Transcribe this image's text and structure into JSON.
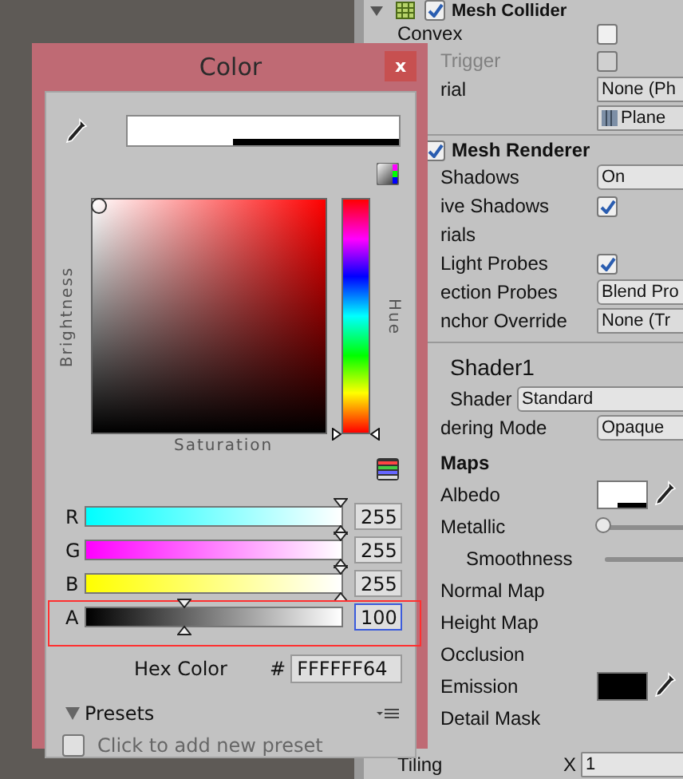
{
  "dialog": {
    "title": "Color",
    "close_label": "x",
    "brightness_label": "Brightness",
    "hue_label": "Hue",
    "saturation_label": "Saturation",
    "hue_slider": {
      "level": 0
    },
    "channels": [
      {
        "kind": "r",
        "label": "R",
        "level": 1,
        "value": "255",
        "focused": false,
        "highlighted": false
      },
      {
        "kind": "g",
        "label": "G",
        "level": 1,
        "value": "255",
        "focused": false,
        "highlighted": false
      },
      {
        "kind": "b",
        "label": "B",
        "level": 1,
        "value": "255",
        "focused": false,
        "highlighted": false
      },
      {
        "kind": "a",
        "label": "A",
        "level": 0.39,
        "value": "100",
        "focused": true,
        "highlighted": true
      }
    ],
    "hex": {
      "label": "Hex Color",
      "prefix": "#",
      "value": "FFFFFF64"
    },
    "presets": {
      "title": "Presets",
      "expanded": true,
      "hint": "Click to add new preset"
    }
  },
  "inspector": {
    "rows": [
      {
        "kind": "component",
        "label": "Mesh Collider",
        "checked": true
      },
      {
        "kind": "checkbox",
        "label": "Convex",
        "checked": false,
        "disabled": false
      },
      {
        "kind": "checkbox",
        "label": "Trigger",
        "checked": false,
        "disabled": true
      },
      {
        "kind": "object",
        "label": "rial",
        "value": "None (Ph"
      },
      {
        "kind": "object",
        "label": "",
        "value": "Plane"
      },
      {
        "kind": "divider"
      },
      {
        "kind": "component",
        "label": "Mesh Renderer",
        "checked": true
      },
      {
        "kind": "dropdown",
        "label": "Shadows",
        "value": "On"
      },
      {
        "kind": "checkbox",
        "label": "ive Shadows",
        "checked": true,
        "disabled": false
      },
      {
        "kind": "label",
        "label": "rials"
      },
      {
        "kind": "checkbox",
        "label": "Light Probes",
        "checked": true,
        "disabled": false
      },
      {
        "kind": "dropdown",
        "label": "ection Probes",
        "value": "Blend Pro"
      },
      {
        "kind": "object",
        "label": "nchor Override",
        "value": "None (Tr"
      },
      {
        "kind": "divider"
      },
      {
        "kind": "material",
        "label": "Shader1"
      },
      {
        "kind": "shader",
        "label": "Shader",
        "value": "Standard"
      },
      {
        "kind": "dropdown",
        "label": "dering Mode",
        "value": "Opaque"
      },
      {
        "kind": "section",
        "label": "Maps"
      },
      {
        "kind": "color",
        "label": "Albedo",
        "color": "#ffffff"
      },
      {
        "kind": "slider",
        "label": "Metallic",
        "level": 0,
        "children": [
          {
            "kind": "track",
            "label": "Smoothness"
          }
        ]
      },
      {
        "kind": "label",
        "label": "Normal Map"
      },
      {
        "kind": "label",
        "label": "Height Map"
      },
      {
        "kind": "label",
        "label": "Occlusion"
      },
      {
        "kind": "color",
        "label": "Emission",
        "color": "#000000"
      },
      {
        "kind": "label",
        "label": "Detail Mask"
      },
      {
        "kind": "vector",
        "label": "Tiling",
        "axis": "X",
        "value": "1"
      }
    ]
  }
}
